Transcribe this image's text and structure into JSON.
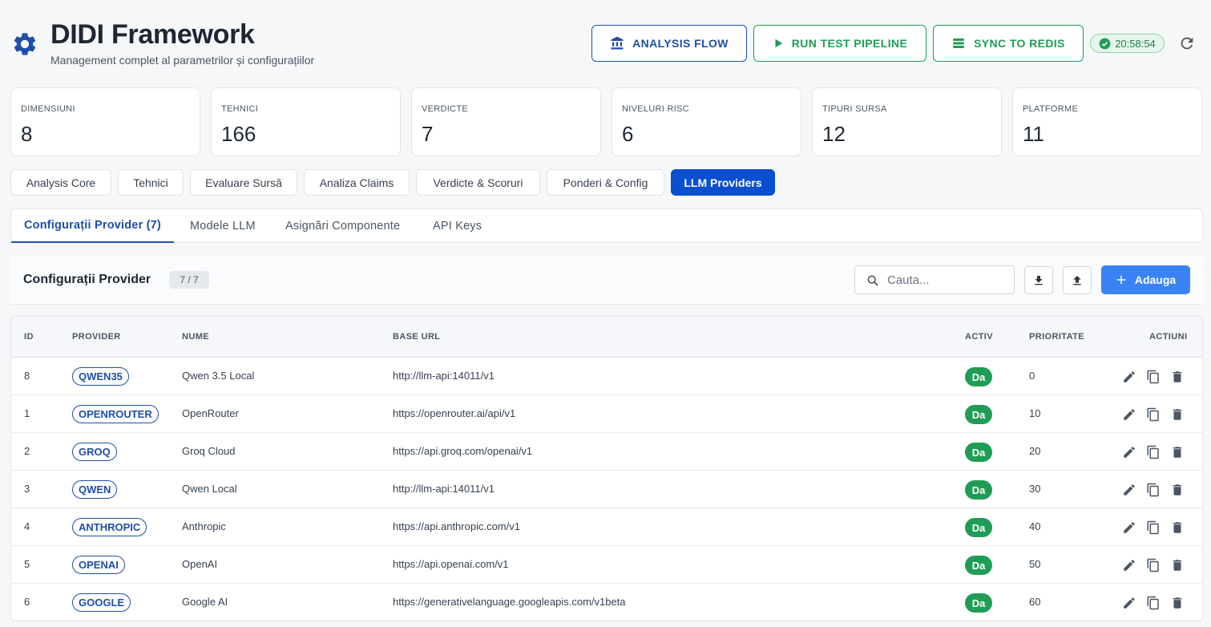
{
  "header": {
    "title": "DIDI Framework",
    "subtitle": "Management complet al parametrilor și configurațiilor",
    "buttons": {
      "analysis_flow": "ANALYSIS FLOW",
      "run_test": "RUN TEST PIPELINE",
      "sync_redis": "SYNC TO REDIS"
    },
    "status_time": "20:58:54"
  },
  "stats": [
    {
      "label": "DIMENSIUNI",
      "value": "8"
    },
    {
      "label": "TEHNICI",
      "value": "166"
    },
    {
      "label": "VERDICTE",
      "value": "7"
    },
    {
      "label": "NIVELURI RISC",
      "value": "6"
    },
    {
      "label": "TIPURI SURSA",
      "value": "12"
    },
    {
      "label": "PLATFORME",
      "value": "11"
    }
  ],
  "main_tabs": [
    {
      "label": "Analysis Core"
    },
    {
      "label": "Tehnici"
    },
    {
      "label": "Evaluare Sursă"
    },
    {
      "label": "Analiza Claims"
    },
    {
      "label": "Verdicte & Scoruri"
    },
    {
      "label": "Ponderi & Config"
    },
    {
      "label": "LLM Providers"
    }
  ],
  "sub_tabs": [
    {
      "label": "Configurații Provider (7)"
    },
    {
      "label": "Modele LLM"
    },
    {
      "label": "Asignări Componente"
    },
    {
      "label": "API Keys"
    }
  ],
  "toolbar": {
    "title": "Configurații Provider",
    "count": "7 / 7",
    "search_placeholder": "Cauta...",
    "add_label": "Adauga"
  },
  "table": {
    "columns": {
      "id": "ID",
      "provider": "PROVIDER",
      "name": "NUME",
      "base_url": "BASE URL",
      "active": "ACTIV",
      "priority": "PRIORITATE",
      "actions": "ACTIUNI"
    },
    "rows": [
      {
        "id": "8",
        "provider": "QWEN35",
        "name": "Qwen 3.5 Local",
        "base_url": "http://llm-api:14011/v1",
        "active": "Da",
        "priority": "0"
      },
      {
        "id": "1",
        "provider": "OPENROUTER",
        "name": "OpenRouter",
        "base_url": "https://openrouter.ai/api/v1",
        "active": "Da",
        "priority": "10"
      },
      {
        "id": "2",
        "provider": "GROQ",
        "name": "Groq Cloud",
        "base_url": "https://api.groq.com/openai/v1",
        "active": "Da",
        "priority": "20"
      },
      {
        "id": "3",
        "provider": "QWEN",
        "name": "Qwen Local",
        "base_url": "http://llm-api:14011/v1",
        "active": "Da",
        "priority": "30"
      },
      {
        "id": "4",
        "provider": "ANTHROPIC",
        "name": "Anthropic",
        "base_url": "https://api.anthropic.com/v1",
        "active": "Da",
        "priority": "40"
      },
      {
        "id": "5",
        "provider": "OPENAI",
        "name": "OpenAI",
        "base_url": "https://api.openai.com/v1",
        "active": "Da",
        "priority": "50"
      },
      {
        "id": "6",
        "provider": "GOOGLE",
        "name": "Google AI",
        "base_url": "https://generativelanguage.googleapis.com/v1beta",
        "active": "Da",
        "priority": "60"
      }
    ]
  },
  "colors": {
    "accent_blue": "#0b4fd1",
    "provider_blue": "#1e4fa8",
    "success_green": "#1f9d55",
    "add_button": "#3b82f6"
  },
  "icons": [
    "gear-icon",
    "bank-icon",
    "play-icon",
    "list-icon",
    "check-circle-icon",
    "refresh-icon",
    "search-icon",
    "download-icon",
    "upload-icon",
    "plus-icon",
    "edit-icon",
    "copy-icon",
    "delete-icon"
  ]
}
